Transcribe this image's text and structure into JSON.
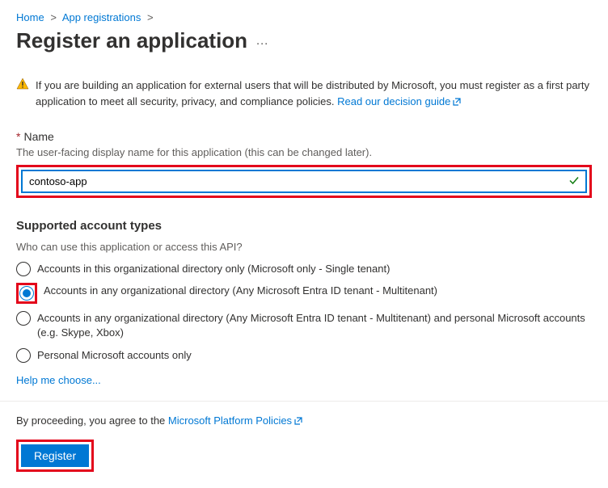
{
  "breadcrumb": {
    "home": "Home",
    "app_reg": "App registrations"
  },
  "title": "Register an application",
  "warning": {
    "text": "If you are building an application for external users that will be distributed by Microsoft, you must register as a first party application to meet all security, privacy, and compliance policies. ",
    "link": "Read our decision guide"
  },
  "name_section": {
    "label": "Name",
    "hint": "The user-facing display name for this application (this can be changed later).",
    "value": "contoso-app"
  },
  "account_types": {
    "heading": "Supported account types",
    "question": "Who can use this application or access this API?",
    "options": [
      "Accounts in this organizational directory only (Microsoft only - Single tenant)",
      "Accounts in any organizational directory (Any Microsoft Entra ID tenant - Multitenant)",
      "Accounts in any organizational directory (Any Microsoft Entra ID tenant - Multitenant) and personal Microsoft accounts (e.g. Skype, Xbox)",
      "Personal Microsoft accounts only"
    ],
    "selected_index": 1,
    "help_link": "Help me choose..."
  },
  "consent": {
    "text": "By proceeding, you agree to the ",
    "link": "Microsoft Platform Policies"
  },
  "register_label": "Register"
}
